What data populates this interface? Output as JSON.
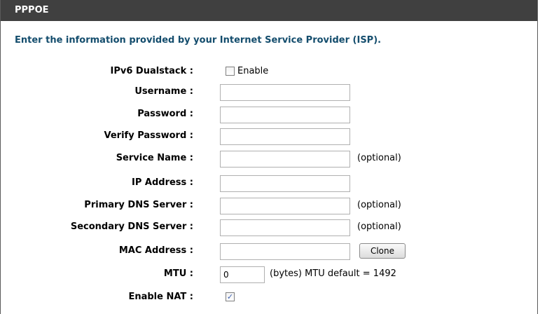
{
  "header": {
    "title": "PPPOE"
  },
  "intro": "Enter the information provided by your Internet Service Provider (ISP).",
  "fields": {
    "dualstack": {
      "label": "IPv6 Dualstack :",
      "checkbox_label": "Enable"
    },
    "username": {
      "label": "Username :",
      "value": ""
    },
    "password": {
      "label": "Password :",
      "value": ""
    },
    "verify_password": {
      "label": "Verify Password :",
      "value": ""
    },
    "service_name": {
      "label": "Service Name :",
      "value": "",
      "note": "(optional)"
    },
    "ip_address": {
      "label": "IP Address :",
      "value": ""
    },
    "primary_dns": {
      "label": "Primary DNS Server :",
      "value": "",
      "note": "(optional)"
    },
    "secondary_dns": {
      "label": "Secondary DNS Server :",
      "value": "",
      "note": "(optional)"
    },
    "mac_address": {
      "label": "MAC Address :",
      "value": "",
      "button": "Clone"
    },
    "mtu": {
      "label": "MTU :",
      "value": "0",
      "note": "(bytes) MTU default = 1492"
    },
    "enable_nat": {
      "label": "Enable NAT :",
      "checked": true
    }
  },
  "colors": {
    "header_bg": "#404040",
    "intro_text": "#144d6d"
  }
}
